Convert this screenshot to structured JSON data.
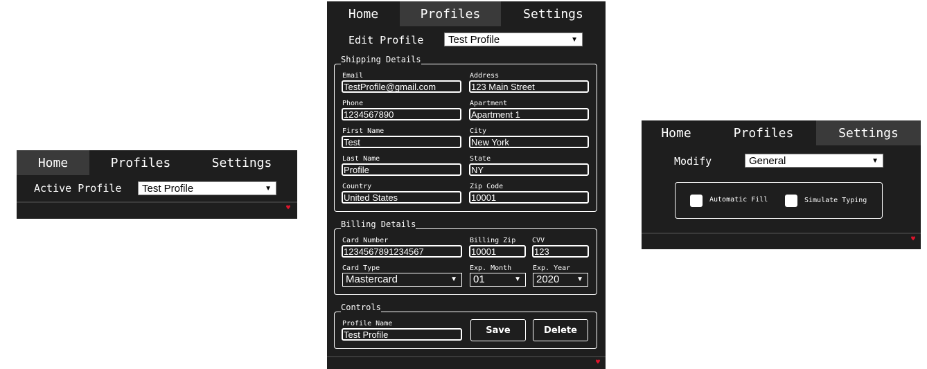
{
  "tabs": [
    "Home",
    "Profiles",
    "Settings"
  ],
  "home": {
    "active_profile_label": "Active Profile",
    "active_profile_value": "Test Profile"
  },
  "profiles": {
    "edit_profile_label": "Edit Profile",
    "edit_profile_value": "Test Profile",
    "shipping_legend": "Shipping Details",
    "email_label": "Email",
    "email": "TestProfile@gmail.com",
    "address_label": "Address",
    "address": "123 Main Street",
    "phone_label": "Phone",
    "phone": "1234567890",
    "apartment_label": "Apartment",
    "apartment": "Apartment 1",
    "first_name_label": "First Name",
    "first_name": "Test",
    "city_label": "City",
    "city": "New York",
    "last_name_label": "Last Name",
    "last_name": "Profile",
    "state_label": "State",
    "state": "NY",
    "country_label": "Country",
    "country": "United States",
    "zip_label": "Zip Code",
    "zip": "10001",
    "billing_legend": "Billing Details",
    "card_number_label": "Card Number",
    "card_number": "1234567891234567",
    "billing_zip_label": "Billing Zip",
    "billing_zip": "10001",
    "cvv_label": "CVV",
    "cvv": "123",
    "card_type_label": "Card Type",
    "card_type": "Mastercard",
    "exp_month_label": "Exp. Month",
    "exp_month": "01",
    "exp_year_label": "Exp. Year",
    "exp_year": "2020",
    "controls_legend": "Controls",
    "profile_name_label": "Profile Name",
    "profile_name": "Test Profile",
    "save_label": "Save",
    "delete_label": "Delete"
  },
  "settings": {
    "modify_label": "Modify",
    "modify_value": "General",
    "automatic_fill_label": "Automatic Fill",
    "simulate_typing_label": "Simulate Typing"
  },
  "icons": {
    "heart": "heart-icon",
    "dropdown": "chevron-down-icon"
  },
  "colors": {
    "panel_bg": "#1e1e1e",
    "tab_active": "#3a3a3a",
    "heart": "#e0142c"
  }
}
